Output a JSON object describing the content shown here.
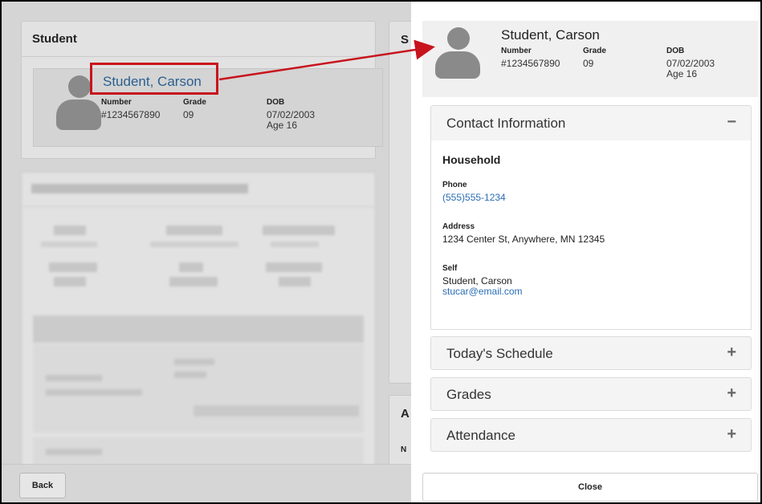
{
  "background": {
    "student_card_title": "Student",
    "student_name": "Student, Carson",
    "number_label": "Number",
    "number_value": "#1234567890",
    "grade_label": "Grade",
    "grade_value": "09",
    "dob_label": "DOB",
    "dob_value": "07/02/2003",
    "age_value": "Age 16",
    "second_card_title_partial": "S",
    "third_card_title_partial": "A",
    "third_card_row_partial": "N",
    "back_label": "Back"
  },
  "panel": {
    "student_name": "Student, Carson",
    "number_label": "Number",
    "number_value": "#1234567890",
    "grade_label": "Grade",
    "grade_value": "09",
    "dob_label": "DOB",
    "dob_value": "07/02/2003",
    "age_value": "Age 16",
    "sections": {
      "contact": {
        "title": "Contact Information",
        "toggle": "−"
      },
      "schedule": {
        "title": "Today's Schedule",
        "toggle": "+"
      },
      "grades": {
        "title": "Grades",
        "toggle": "+"
      },
      "attendance": {
        "title": "Attendance",
        "toggle": "+"
      }
    },
    "contact": {
      "household_title": "Household",
      "phone_label": "Phone",
      "phone_value": "(555)555-1234",
      "address_label": "Address",
      "address_value": "1234 Center St, Anywhere, MN 12345",
      "self_label": "Self",
      "self_name": "Student, Carson",
      "self_email": "stucar@email.com"
    },
    "close_label": "Close"
  },
  "colors": {
    "highlight": "#c8141d",
    "link": "#2a6db5",
    "arrow": "#c8141d"
  }
}
